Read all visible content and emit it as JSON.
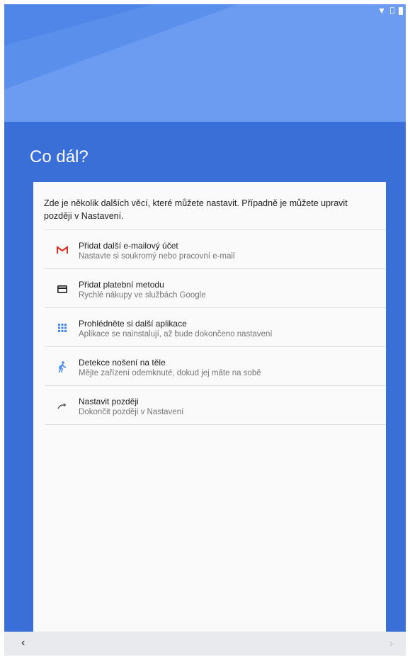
{
  "header": {
    "title": "Co dál?"
  },
  "card": {
    "intro": "Zde je několik dalších věcí, které můžete nastavit. Případně je můžete upravit později v Nastavení."
  },
  "items": [
    {
      "title": "Přidat další e-mailový účet",
      "subtitle": "Nastavte si soukromý nebo pracovní e-mail",
      "icon": "gmail-icon"
    },
    {
      "title": "Přidat platební metodu",
      "subtitle": "Rychlé nákupy ve službách Google",
      "icon": "credit-card-icon"
    },
    {
      "title": "Prohlédněte si další aplikace",
      "subtitle": "Aplikace se nainstalují, až bude dokončeno nastavení",
      "icon": "apps-grid-icon"
    },
    {
      "title": "Detekce nošení na těle",
      "subtitle": "Mějte zařízení odemknuté, dokud jej máte na sobě",
      "icon": "walking-person-icon"
    },
    {
      "title": "Nastavit později",
      "subtitle": "Dokončit později v Nastavení",
      "icon": "redo-arrow-icon"
    }
  ],
  "nav": {
    "back": "‹",
    "next": "›"
  },
  "colors": {
    "background_blue": "#3a6fd8",
    "hero_blue": "#6b9cf2",
    "gmail_red": "#d93025",
    "accent_blue": "#4285f4"
  }
}
